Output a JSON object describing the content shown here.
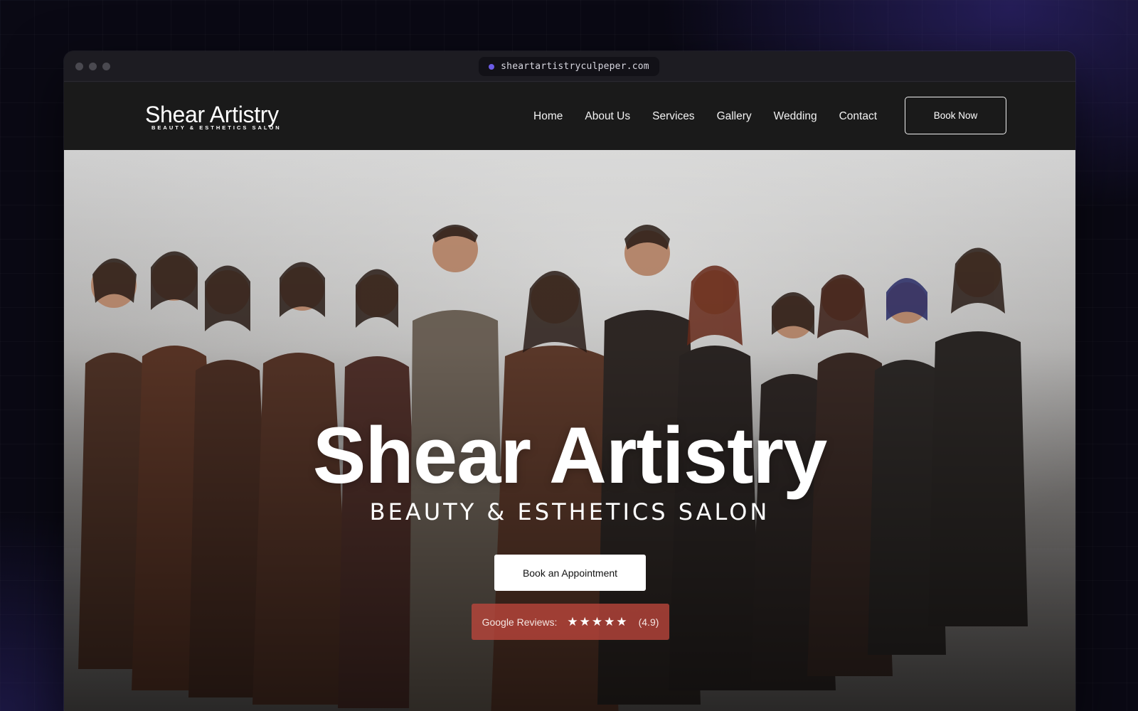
{
  "browser": {
    "url": "sheartartistryculpeper.com"
  },
  "site": {
    "logo": {
      "name": "Shear Artistry",
      "tagline": "BEAUTY & ESTHETICS SALON"
    },
    "nav": [
      {
        "label": "Home"
      },
      {
        "label": "About Us"
      },
      {
        "label": "Services"
      },
      {
        "label": "Gallery"
      },
      {
        "label": "Wedding"
      },
      {
        "label": "Contact"
      }
    ],
    "book_now_label": "Book Now"
  },
  "hero": {
    "title": "Shear Artistry",
    "subtitle": "BEAUTY & ESTHETICS SALON",
    "cta_label": "Book an Appointment",
    "reviews": {
      "label": "Google Reviews:",
      "stars": "★★★★★",
      "rating": "(4.9)",
      "rating_value": 4.9
    },
    "image_description_colors": {
      "clothing": "#5a3a2c",
      "backdrop": "#c9c8c7"
    }
  },
  "colors": {
    "nav_bg": "#1a1a1a",
    "accent_url_dot": "#6c5ce7",
    "reviews_bg": "#be463c"
  }
}
